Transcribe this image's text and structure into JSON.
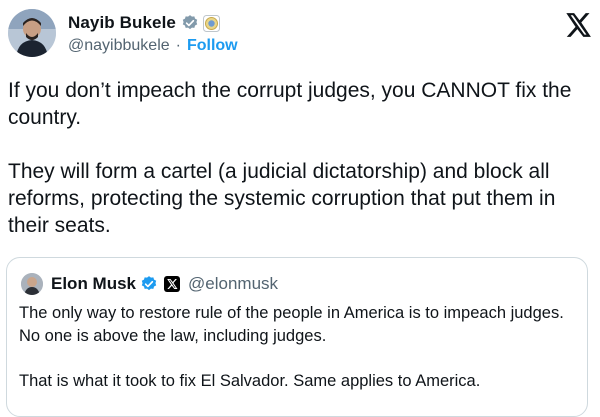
{
  "author": {
    "name": "Nayib Bukele",
    "handle": "@nayibbukele",
    "separator": "·",
    "follow_label": "Follow",
    "icons": [
      "verified-badge-icon",
      "government-seal-icon"
    ]
  },
  "platform": {
    "logo": "x-logo-icon"
  },
  "tweet": {
    "paragraph_1": "If you don’t impeach the corrupt judges, you CANNOT fix the country.",
    "paragraph_2": "They will form a cartel (a judicial dictatorship) and block all reforms, protecting the systemic corruption that put them in their seats."
  },
  "quoted_tweet": {
    "author_name": "Elon Musk",
    "handle": "@elonmusk",
    "icons": [
      "verified-badge-icon",
      "x-affiliate-badge-icon"
    ],
    "paragraph_1": "The only way to restore rule of the people in America is to impeach judges. No one is above the law, including judges.",
    "paragraph_2": "That is what it took to fix El Salvador. Same applies to America."
  },
  "colors": {
    "text": "#0f1419",
    "secondary": "#536471",
    "accent": "#1d9bf0",
    "border": "#cfd9de",
    "verified": "#1d9bf0",
    "seal": "#c9a94a"
  }
}
